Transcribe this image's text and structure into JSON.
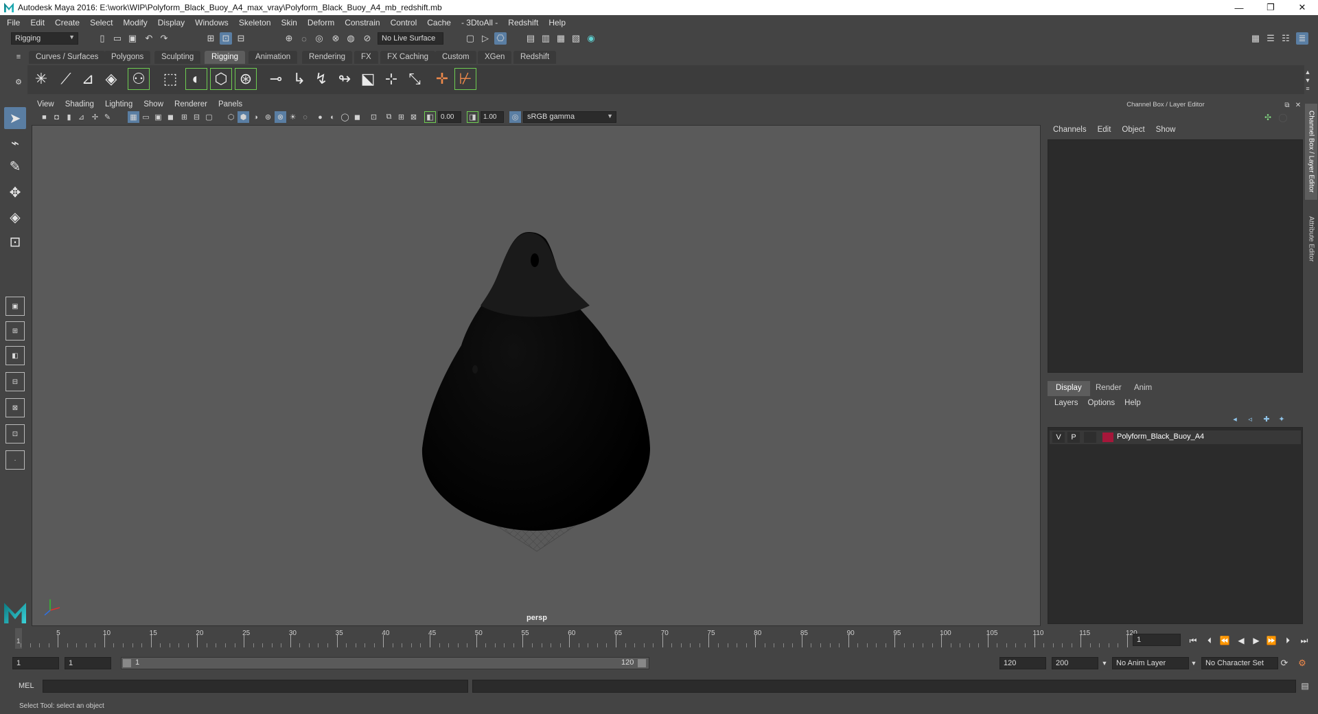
{
  "window": {
    "title": "Autodesk Maya 2016: E:\\work\\WIP\\Polyform_Black_Buoy_A4_max_vray\\Polyform_Black_Buoy_A4_mb_redshift.mb",
    "minimize": "—",
    "restore": "❐",
    "close": "✕"
  },
  "menubar": [
    "File",
    "Edit",
    "Create",
    "Select",
    "Modify",
    "Display",
    "Windows",
    "Skeleton",
    "Skin",
    "Deform",
    "Constrain",
    "Control",
    "Cache",
    "- 3DtoAll -",
    "Redshift",
    "Help"
  ],
  "statusline": {
    "menuset": "Rigging",
    "live_surface": "No Live Surface"
  },
  "shelf": {
    "tabs": [
      "Curves / Surfaces",
      "Polygons",
      "Sculpting",
      "Rigging",
      "Animation",
      "Rendering",
      "FX",
      "FX Caching",
      "Custom",
      "XGen",
      "Redshift"
    ],
    "active_tab": "Rigging"
  },
  "panel": {
    "menu": [
      "View",
      "Shading",
      "Lighting",
      "Show",
      "Renderer",
      "Panels"
    ],
    "exposure": "0.00",
    "gamma": "1.00",
    "color_space": "sRGB gamma",
    "camera": "persp"
  },
  "channelbox": {
    "title": "Channel Box / Layer Editor",
    "menu": [
      "Channels",
      "Edit",
      "Object",
      "Show"
    ]
  },
  "layereditor": {
    "tabs": [
      "Display",
      "Render",
      "Anim"
    ],
    "active_tab": "Display",
    "menu": [
      "Layers",
      "Options",
      "Help"
    ],
    "layers": [
      {
        "visible": "V",
        "playback": "P",
        "name": "Polyform_Black_Buoy_A4",
        "color": "#a5173a"
      }
    ]
  },
  "side_tabs": [
    "Channel Box / Layer Editor",
    "Attribute Editor"
  ],
  "timeslider": {
    "start_label": "1",
    "labels": [
      "5",
      "10",
      "15",
      "20",
      "25",
      "30",
      "35",
      "40",
      "45",
      "50",
      "55",
      "60",
      "65",
      "70",
      "75",
      "80",
      "85",
      "90",
      "95",
      "100",
      "105",
      "110",
      "115",
      "120"
    ],
    "current_frame": "1"
  },
  "range": {
    "start": "1",
    "playback_start": "1",
    "range_start": "1",
    "range_end": "120",
    "playback_end": "120",
    "end": "200",
    "anim_layer": "No Anim Layer",
    "character_set": "No Character Set"
  },
  "commandline": {
    "language": "MEL"
  },
  "helpline": {
    "text": "Select Tool: select an object"
  },
  "colors": {
    "ui_bg": "#444444",
    "viewport_bg": "#5a5a5a",
    "selected": "#5a7ea3",
    "layer_color": "#a5173a"
  }
}
